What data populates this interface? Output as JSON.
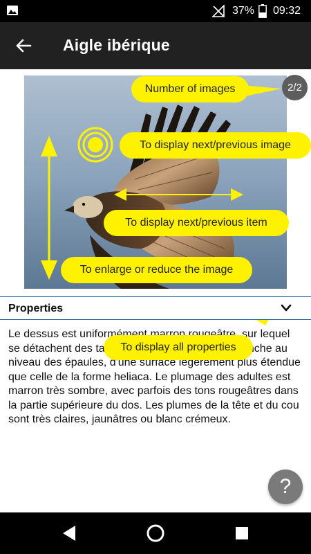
{
  "status_bar": {
    "battery": "37%",
    "time": "09:32"
  },
  "toolbar": {
    "title": "Aigle ibérique"
  },
  "image": {
    "counter": "2/2"
  },
  "tutorial": {
    "number_of_images": "Number of images",
    "next_previous_image": "To display next/previous image",
    "next_previous_item": "To display next/previous item",
    "enlarge_reduce": "To enlarge or reduce the image",
    "all_properties": "To display all properties",
    "accent_color": "#fff200"
  },
  "properties": {
    "label": "Properties",
    "description": "Le dessus est uniformément marron rougeâtre, sur lequel se détachent des taches blanches de couleur blanche au niveau des épaules, d'une surface légèrement plus étendue que celle de la forme heliaca. Le plumage des adultes est marron très sombre, avec parfois des tons rougeâtres dans la partie supérieure du dos. Les plumes de la tête et du cou sont très claires, jaunâtres ou blanc crémeux."
  },
  "help": {
    "label": "?"
  },
  "icons": [
    "gallery-icon",
    "no-signal-icon",
    "battery-icon",
    "back-arrow-icon",
    "chevron-down-icon",
    "swipe-target-icon",
    "back-triangle-icon",
    "home-circle-icon",
    "recents-square-icon"
  ]
}
